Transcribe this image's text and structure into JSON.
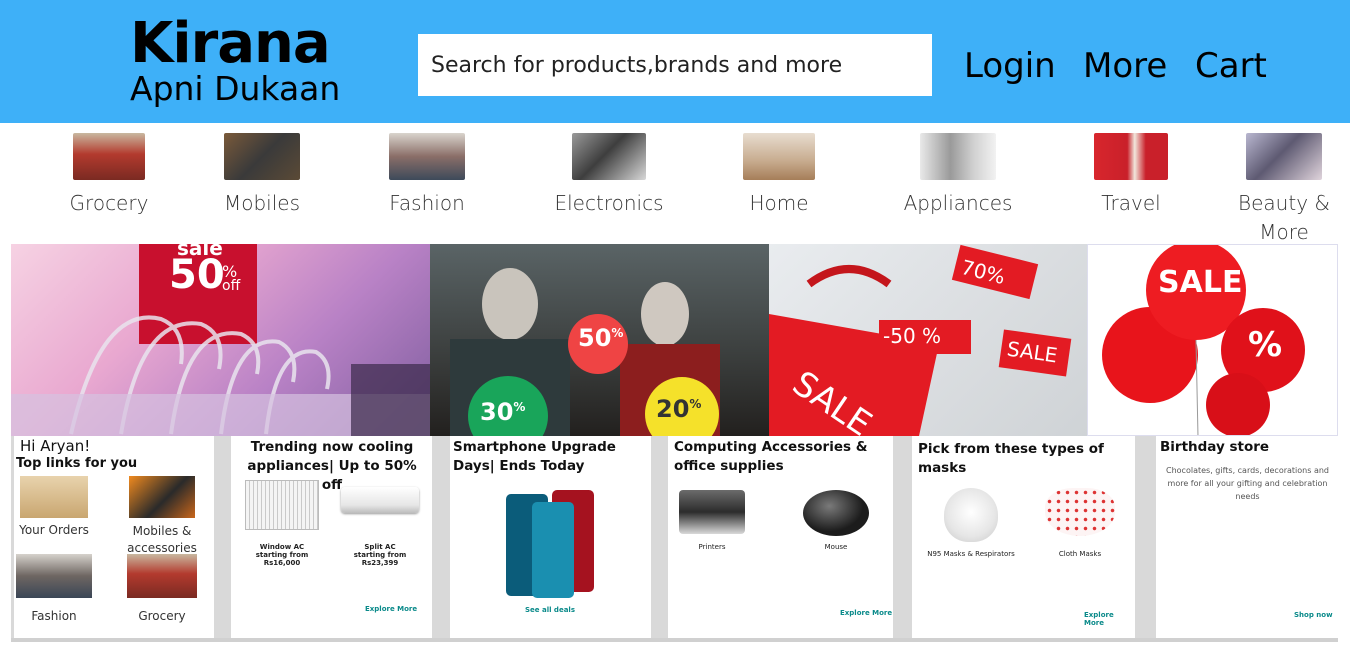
{
  "header": {
    "brand_title": "Kirana",
    "brand_subtitle": "Apni Dukaan",
    "search_placeholder": "Search for products,brands and more",
    "nav": [
      "Login",
      "More",
      "Cart"
    ],
    "bg_color": "#3eb0f8"
  },
  "categories": [
    {
      "label": "Grocery",
      "icon": "grocery-cart-image"
    },
    {
      "label": "Mobiles",
      "icon": "mobile-phone-image"
    },
    {
      "label": "Fashion",
      "icon": "clothes-rack-image"
    },
    {
      "label": "Electronics",
      "icon": "headphones-image"
    },
    {
      "label": "Home",
      "icon": "living-room-image"
    },
    {
      "label": "Appliances",
      "icon": "kitchen-appliances-image"
    },
    {
      "label": "Travel",
      "icon": "traveler-image"
    },
    {
      "label": "Beauty &",
      "label2": "More",
      "icon": "makeup-brushes-image"
    }
  ],
  "banners": [
    {
      "text1": "sale",
      "text2": "50",
      "text3": "%",
      "text4": "off"
    },
    {
      "badge1": "50",
      "badge2": "30",
      "badge3": "20",
      "pct": "%"
    },
    {
      "tag1": "70%",
      "tag2": "-50 %",
      "tag3": "SALE",
      "bag": "SALE"
    },
    {
      "balloon1": "SALE",
      "balloon2": "%"
    }
  ],
  "cards": {
    "greeting": "Hi Aryan!",
    "top_links_title": "Top links for you",
    "top_links": [
      "Your Orders",
      "Mobiles &",
      "accessories",
      "Fashion",
      "Grocery"
    ],
    "trending_title": "Trending now cooling appliances| Up to 50% off",
    "trending_items": [
      {
        "name": "Window AC",
        "price": "starting from Rs16,000"
      },
      {
        "name": "Split AC",
        "price": "starting from Rs23,399"
      }
    ],
    "trending_link": "Explore More",
    "smartphone_title": "Smartphone Upgrade Days| Ends Today",
    "smartphone_link": "See all deals",
    "computing_title": "Computing Accessories & office supplies",
    "computing_items": [
      "Printers",
      "Mouse"
    ],
    "computing_link": "Explore More",
    "masks_title": "Pick from these types of masks",
    "masks_items": [
      "N95 Masks & Respirators",
      "Cloth Masks"
    ],
    "masks_link": "Explore More",
    "birthday_title": "Birthday store",
    "birthday_desc": "Chocolates, gifts, cards, decorations and more for all your gifting and celebration needs",
    "birthday_link": "Shop now"
  }
}
